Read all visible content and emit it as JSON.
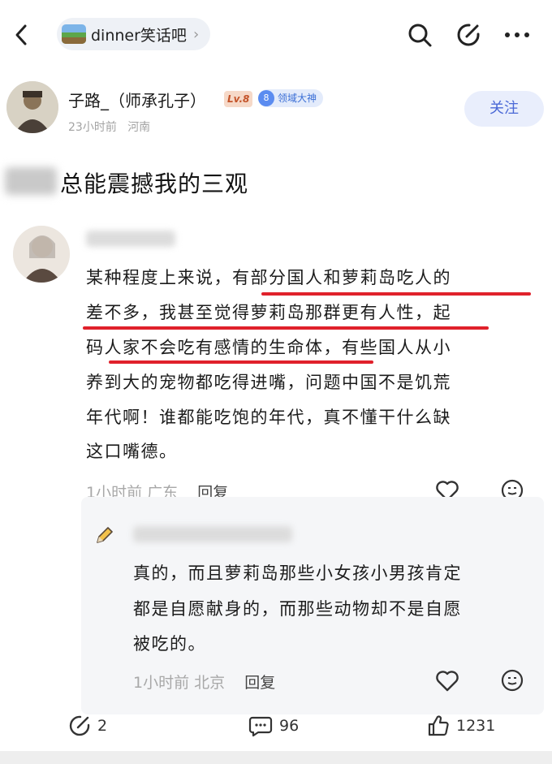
{
  "header": {
    "forum_name": "dinner笑话吧",
    "forum_arrow": "›"
  },
  "author": {
    "name": "子路_（师承孔子）",
    "level_badge": "Lv.8",
    "domain_badge_number": "8",
    "domain_badge": "领域大神",
    "time": "23小时前",
    "location": "河南",
    "follow_label": "关注"
  },
  "post": {
    "title": "总能震撼我的三观"
  },
  "comment": {
    "lines": [
      "某种程度上来说，有部分国人和萝莉岛吃人的",
      "差不多，我甚至觉得萝莉岛那群更有人性，起",
      "码人家不会吃有感情的生命体，有些国人从小",
      "养到大的宠物都吃得进嘴，问题中国不是饥荒",
      "年代啊！谁都能吃饱的年代，真不懂干什么缺",
      "这口嘴德。"
    ],
    "time": "1小时前",
    "location": "广东",
    "reply_label": "回复"
  },
  "reply": {
    "lines": [
      "真的，而且萝莉岛那些小女孩小男孩肯定",
      "都是自愿献身的，而那些动物却不是自愿",
      "被吃的。"
    ],
    "time": "1小时前",
    "location": "北京",
    "reply_label": "回复"
  },
  "bottom_bar": {
    "share_count": "2",
    "comment_count": "96",
    "like_count": "1231"
  },
  "colors": {
    "underline": "#e0212b",
    "follow_text": "#4a68d6",
    "follow_bg": "#e9eefc"
  }
}
